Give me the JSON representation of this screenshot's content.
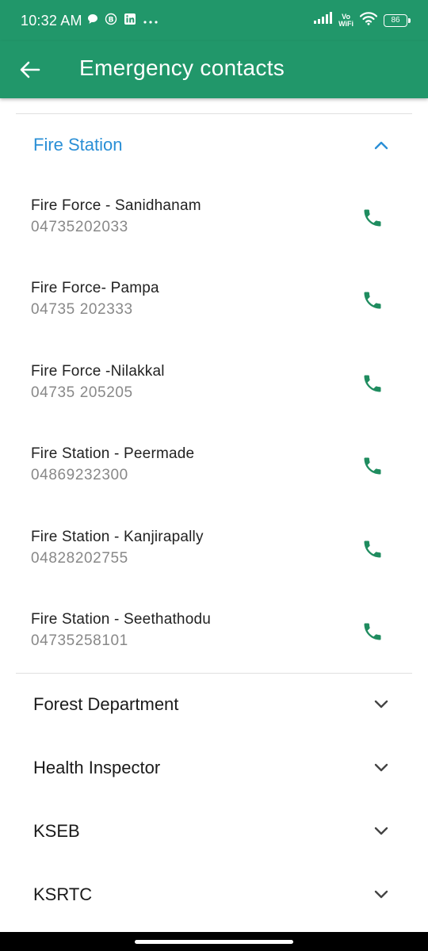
{
  "status_bar": {
    "time": "10:32 AM",
    "left_icons": [
      "chat-bubble-icon",
      "b-circle-icon",
      "linkedin-icon",
      "more-dots-icon"
    ],
    "vowifi_top": "Vo",
    "vowifi_bottom": "WiFi",
    "battery": "86"
  },
  "app_bar": {
    "title": "Emergency contacts",
    "back_icon": "arrow-left-icon"
  },
  "colors": {
    "primary": "#21976a",
    "accent_blue": "#2a8fd6",
    "phone_icon": "#1f8c5f"
  },
  "expanded_section": {
    "title": "Fire Station",
    "contacts": [
      {
        "name": "Fire Force - Sanidhanam",
        "phone": "04735202033"
      },
      {
        "name": "Fire Force- Pampa",
        "phone": "04735 202333"
      },
      {
        "name": "Fire Force -Nilakkal",
        "phone": "04735 205205"
      },
      {
        "name": "Fire Station - Peermade",
        "phone": "04869232300"
      },
      {
        "name": "Fire Station - Kanjirapally",
        "phone": "04828202755"
      },
      {
        "name": "Fire Station - Seethathodu",
        "phone": "04735258101"
      }
    ]
  },
  "collapsed_sections": [
    {
      "title": "Forest Department"
    },
    {
      "title": "Health Inspector"
    },
    {
      "title": "KSEB"
    },
    {
      "title": "KSRTC"
    }
  ]
}
